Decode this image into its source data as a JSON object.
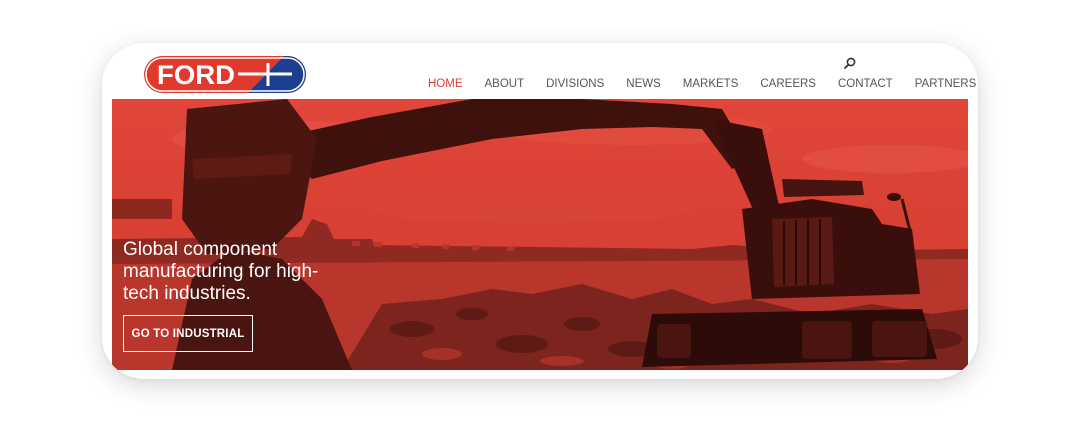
{
  "brand": {
    "logo_text": "FORD"
  },
  "header": {
    "search_icon": "search-icon",
    "nav": [
      {
        "label": "HOME",
        "active": true
      },
      {
        "label": "ABOUT",
        "active": false
      },
      {
        "label": "DIVISIONS",
        "active": false
      },
      {
        "label": "NEWS",
        "active": false
      },
      {
        "label": "MARKETS",
        "active": false
      },
      {
        "label": "CAREERS",
        "active": false
      },
      {
        "label": "CONTACT",
        "active": false
      },
      {
        "label": "PARTNERS",
        "active": false
      }
    ]
  },
  "hero": {
    "headline": "Global component manufacturing for high-tech industries.",
    "cta_label": "GO TO INDUSTRIAL"
  },
  "colors": {
    "accent": "#e2392e",
    "logo_blue": "#1d3f8f",
    "hero_tint": "#d73b2f"
  }
}
